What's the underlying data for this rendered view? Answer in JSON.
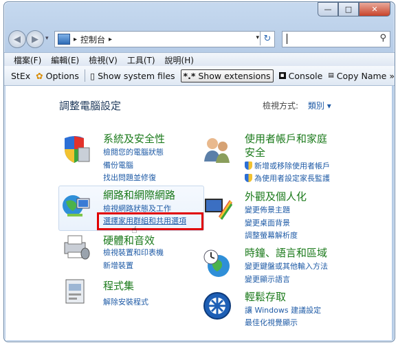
{
  "window": {
    "controls": {
      "minimize": "—",
      "maximize": "□",
      "close": "✕"
    }
  },
  "address": {
    "breadcrumb": [
      "控制台"
    ],
    "search_placeholder": ""
  },
  "menu": [
    "檔案(F)",
    "編輯(E)",
    "檢視(V)",
    "工具(T)",
    "說明(H)"
  ],
  "toolbar": {
    "stex": "StEx",
    "options": "Options",
    "show_system_files": "Show system files",
    "show_extensions": "Show extensions",
    "console": "Console",
    "copy_name": "Copy Name",
    "more": "»"
  },
  "page": {
    "title": "調整電腦設定",
    "view_by_label": "檢視方式:",
    "view_by_value": "類別 ▾"
  },
  "categories": {
    "security": {
      "title": "系統及安全性",
      "links": [
        "檢閱您的電腦狀態",
        "備份電腦",
        "找出問題並修復"
      ]
    },
    "network": {
      "title": "網路和網際網路",
      "links": [
        "檢視網路狀態及工作",
        "選擇家用群組和共用選項"
      ]
    },
    "hardware": {
      "title": "硬體和音效",
      "links": [
        "檢視裝置和印表機",
        "新增裝置"
      ]
    },
    "programs": {
      "title": "程式集",
      "links": [
        "解除安裝程式"
      ]
    },
    "users": {
      "title_line1": "使用者帳戶和家庭",
      "title_line2": "安全",
      "links": [
        "新增或移除使用者帳戶",
        "為使用者設定家長監護"
      ]
    },
    "appearance": {
      "title": "外觀及個人化",
      "links": [
        "變更佈景主題",
        "變更桌面背景",
        "調整螢幕解析度"
      ]
    },
    "clock": {
      "title": "時鐘、語言和區域",
      "links": [
        "變更鍵盤或其他輸入方法",
        "變更顯示語言"
      ]
    },
    "ease": {
      "title": "輕鬆存取",
      "links": [
        "讓 Windows 建議設定",
        "最佳化視覺顯示"
      ]
    }
  },
  "colors": {
    "link": "#1f5ba6",
    "category": "#1b7a1b",
    "highlight_border": "#e00000"
  }
}
